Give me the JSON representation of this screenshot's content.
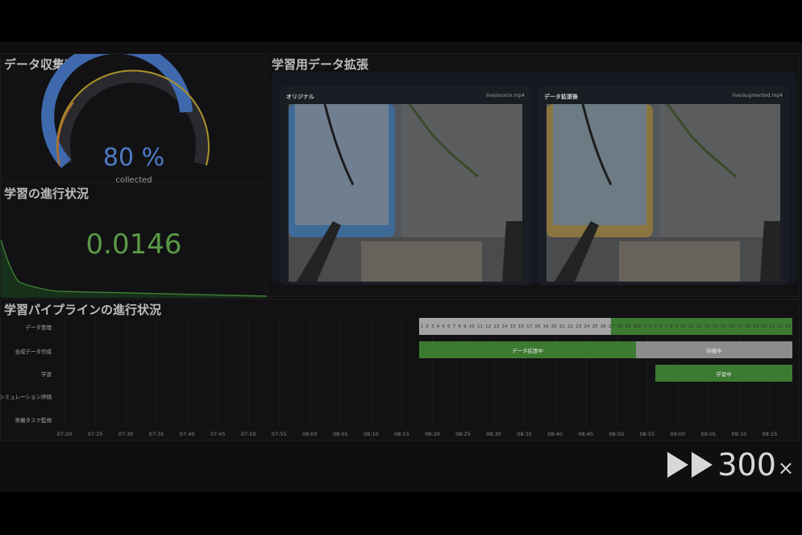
{
  "gauge": {
    "title": "データ収集率",
    "value": "80 %",
    "subtitle": "collected",
    "fraction": 0.8,
    "color": "#4f7ac4"
  },
  "progress": {
    "title": "学習の進行状況",
    "value": "0.0146"
  },
  "augment": {
    "title": "学習用データ拡張",
    "left": {
      "label": "オリジナル",
      "path": "live/source.mp4"
    },
    "right": {
      "label": "データ拡張後",
      "path": "live/augmented.mp4"
    }
  },
  "pipeline": {
    "title": "学習パイプラインの進行状況",
    "lanes": [
      "データ管理",
      "合成データ作成",
      "学習",
      "シミュレーション評価",
      "実機タスク監視"
    ],
    "ticks": [
      "07:20",
      "07:25",
      "07:30",
      "07:35",
      "07:40",
      "07:45",
      "07:50",
      "07:55",
      "08:00",
      "08:05",
      "08:10",
      "08:15",
      "08:20",
      "08:25",
      "08:30",
      "08:35",
      "08:40",
      "08:45",
      "08:50",
      "08:55",
      "09:00",
      "09:05",
      "09:10",
      "09:15"
    ],
    "cells_a": [
      "1",
      "2",
      "3",
      "4",
      "5",
      "6",
      "7",
      "8",
      "9",
      "10",
      "11",
      "12",
      "13",
      "14",
      "15",
      "16",
      "17",
      "18",
      "19",
      "20",
      "21",
      "22",
      "23",
      "24",
      "25",
      "26",
      "27",
      "28",
      "29",
      "30"
    ],
    "cells_b": [
      "1",
      "2",
      "3",
      "4",
      "5",
      "6",
      "7",
      "8",
      "9",
      "10",
      "11",
      "12",
      "13",
      "14",
      "15",
      "16",
      "17",
      "18",
      "19",
      "20",
      "21",
      "22",
      "23"
    ],
    "bar_aug": "データ拡張中",
    "bar_wait": "待機中",
    "bar_train": "学習中",
    "colors": {
      "green": "#3d7a31",
      "gray": "#8c8c8c",
      "light": "#a5a5a5"
    }
  },
  "speed": {
    "value": "300",
    "suffix": "×"
  }
}
